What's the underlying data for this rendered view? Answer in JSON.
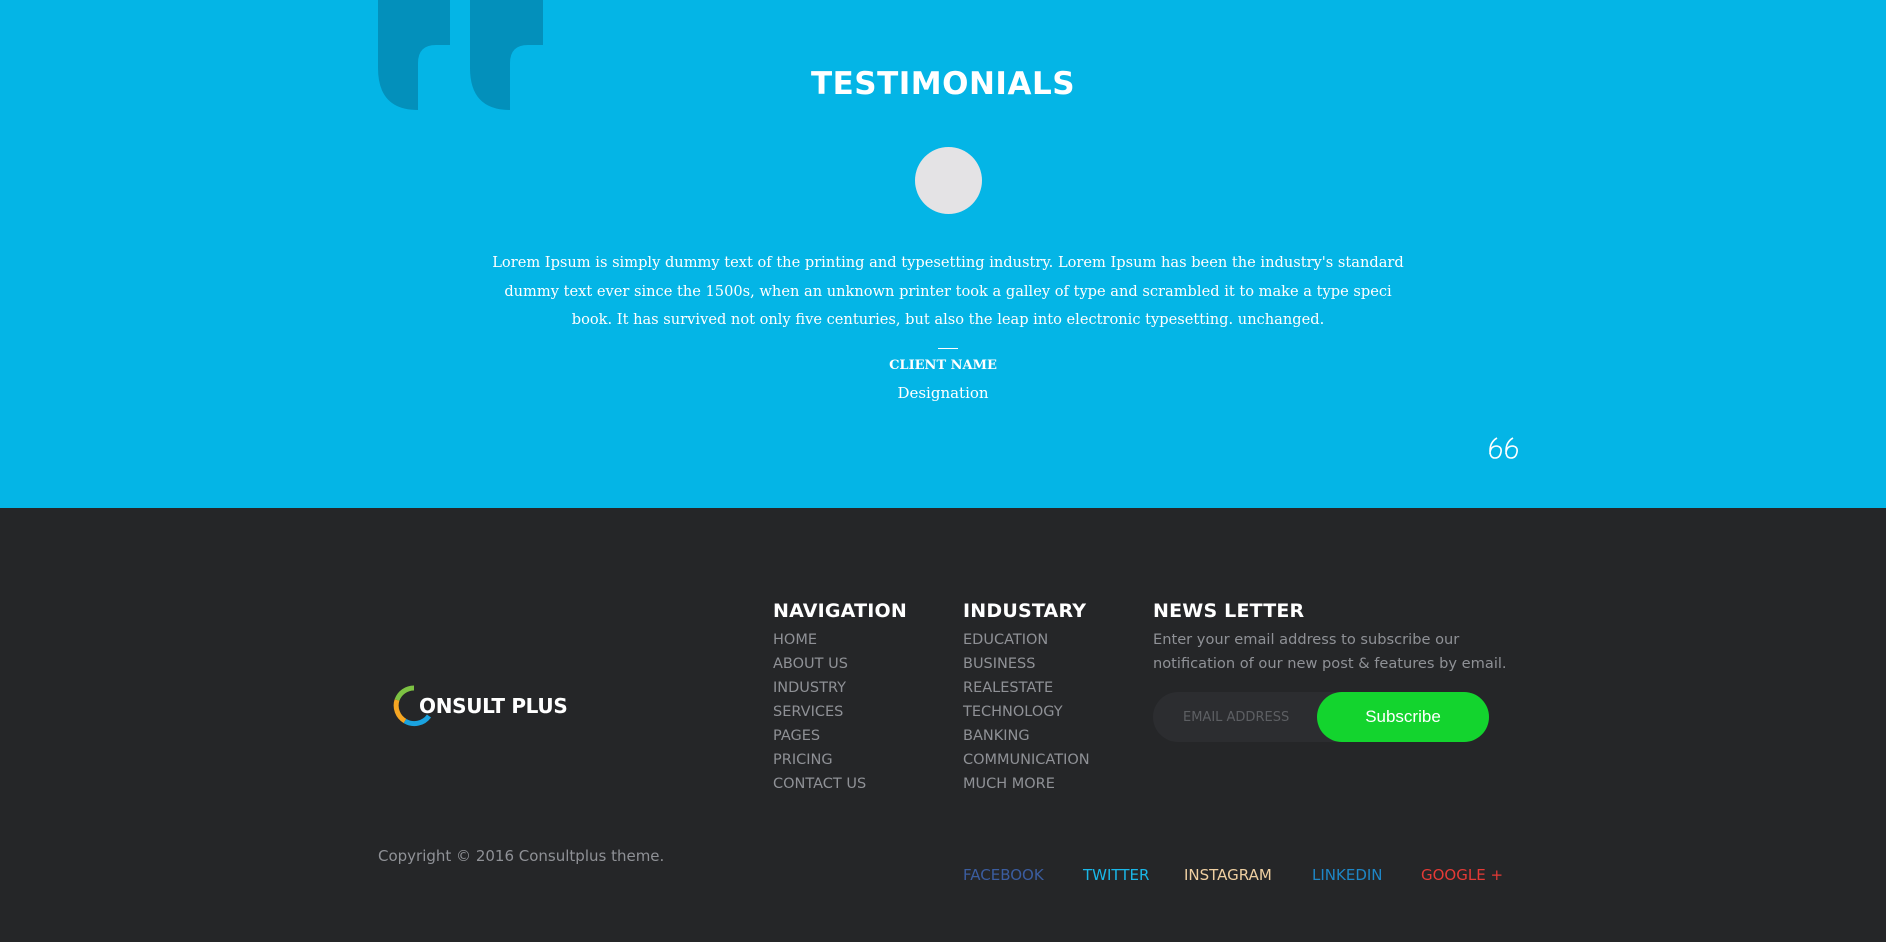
{
  "colors": {
    "testimonial_bg": "#04b5e6",
    "footer_bg": "#252628",
    "subscribe_button": "#13d42e",
    "facebook": "#3b5da0",
    "twitter": "#1ab7e8",
    "instagram": "#efcfa1",
    "linkedin": "#1e86c6",
    "google": "#e53a36"
  },
  "testimonials": {
    "title": "TESTIMONIALS",
    "text": "Lorem Ipsum is simply dummy text of the printing and typesetting industry. Lorem Ipsum has been the industry's standard dummy text ever since the 1500s, when an unknown printer took a galley of type and scrambled it to make a type speci book. It has survived not only five centuries, but also the leap into electronic typesetting. unchanged.",
    "client_name": "CLIENT NAME",
    "designation": "Designation",
    "decor_icon": "quote-icon",
    "nav_icon": "quote-small-icon"
  },
  "footer": {
    "logo_text": "ONSULT PLUS",
    "navigation": {
      "title": "NAVIGATION",
      "items": [
        "HOME",
        "ABOUT US",
        "INDUSTRY",
        "SERVICES",
        "PAGES",
        "PRICING",
        "CONTACT US"
      ]
    },
    "industry": {
      "title": "INDUSTARY",
      "items": [
        "EDUCATION",
        "BUSINESS",
        "REALESTATE",
        "TECHNOLOGY",
        "BANKING",
        "COMMUNICATION",
        "MUCH MORE"
      ]
    },
    "newsletter": {
      "title": "NEWS LETTER",
      "description_line1": "Enter your email address to subscribe our",
      "description_line2": "notification of our new post & features by email.",
      "email_placeholder": "EMAIL ADDRESS",
      "subscribe_label": "Subscribe"
    },
    "copyright": "Copyright © 2016 Consultplus theme.",
    "social": {
      "facebook": "FACEBOOK",
      "twitter": "TWITTER",
      "instagram": "INSTAGRAM",
      "linkedin": "LINKEDIN",
      "google": "GOOGLE +"
    }
  }
}
